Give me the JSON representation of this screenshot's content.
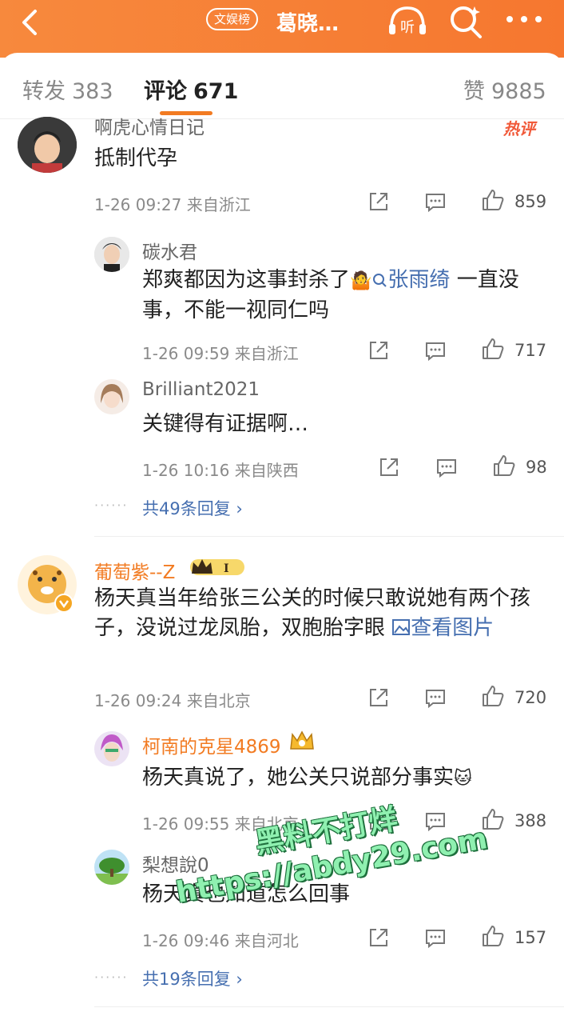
{
  "header": {
    "badge": "文娱榜",
    "title": "葛晓…",
    "colors": {
      "accent": "#f6772f",
      "link": "#466fb0",
      "hot": "#f15a3a"
    }
  },
  "tabs": [
    {
      "label": "转发",
      "count": "383"
    },
    {
      "label": "评论",
      "count": "671"
    },
    {
      "label": "赞",
      "count": "9885"
    }
  ],
  "hot_label": "热评",
  "comments": [
    {
      "name": "啊虎心情日记",
      "text": "抵制代孕",
      "time": "1-26 09:27",
      "location": "来自浙江",
      "likes": "859",
      "replies": [
        {
          "name": "碳水君",
          "text_before": "郑爽都因为这事封杀了",
          "mention": "张雨绮",
          "text_after": " 一直没事，不能一视同仁吗",
          "time": "1-26 09:59",
          "location": "来自浙江",
          "likes": "717"
        },
        {
          "name": "Brilliant2021",
          "text": "关键得有证据啊…",
          "time": "1-26 10:16",
          "location": "来自陕西",
          "likes": "98"
        }
      ],
      "more_replies": "共49条回复 ›"
    },
    {
      "name": "葡萄紫--Z",
      "text": "杨天真当年给张三公关的时候只敢说她有两个孩子，没说过龙凤胎，双胞胎字眼",
      "view_image": "查看图片",
      "time": "1-26 09:24",
      "location": "来自北京",
      "likes": "720",
      "replies": [
        {
          "name": "柯南的克星4869",
          "text": "杨天真说了，她公关只说部分事实",
          "time": "1-26 09:55",
          "location": "来自北京",
          "likes": "388"
        },
        {
          "name": "梨想說0",
          "text": "杨天真也知道怎么回事",
          "time": "1-26 09:46",
          "location": "来自河北",
          "likes": "157"
        }
      ],
      "more_replies": "共19条回复 ›"
    }
  ],
  "watermark": {
    "line1": "黑料不打烊",
    "line2": "https://abdy29.com"
  },
  "icons": [
    "back-icon",
    "listen-icon",
    "search-icon",
    "more-icon",
    "share-icon",
    "comment-icon",
    "like-icon",
    "search-mention-icon",
    "image-icon",
    "vip-crown-icon",
    "verified-icon"
  ]
}
